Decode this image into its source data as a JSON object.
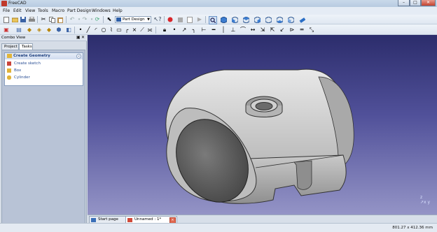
{
  "window": {
    "title": "FreeCAD",
    "minimize": "–",
    "maximize": "□",
    "close": "✕"
  },
  "menu": [
    "File",
    "Edit",
    "View",
    "Tools",
    "Macro",
    "Part Design",
    "Windows",
    "Help"
  ],
  "toolbar1": {
    "workbench": "Part Design",
    "icons": [
      "new-document-icon",
      "open-icon",
      "save-icon",
      "print-icon",
      "cut-icon",
      "copy-icon",
      "paste-icon",
      "undo-icon",
      "redo-icon",
      "refresh-icon",
      "pointer-icon",
      "whats-this-icon",
      "record-macro-icon",
      "stop-macro-icon",
      "edit-macro-icon",
      "run-macro-icon",
      "fit-all-icon",
      "axonometric-icon",
      "front-view-icon",
      "top-view-icon",
      "right-view-icon",
      "rear-view-icon",
      "bottom-view-icon",
      "left-view-icon",
      "measure-icon"
    ]
  },
  "toolbar2": {
    "icons": [
      "new-sketch-icon",
      "leave-sketch-icon",
      "view-sketch-icon",
      "map-sketch-icon",
      "reorient-sketch-icon",
      "validate-sketch-icon",
      "point-icon",
      "line-icon",
      "arc-icon",
      "circle-icon",
      "polyline-icon",
      "rectangle-icon",
      "fillet-icon",
      "trim-icon",
      "external-geometry-icon",
      "construction-mode-icon",
      "lock-constraint-icon",
      "coincident-constraint-icon",
      "point-on-object-icon",
      "vertical-constraint-icon",
      "horizontal-constraint-icon",
      "parallel-constraint-icon",
      "perpendicular-constraint-icon",
      "tangent-constraint-icon",
      "equal-constraint-icon",
      "symmetric-constraint-icon",
      "distance-constraint-icon",
      "horizontal-distance-icon",
      "vertical-distance-icon",
      "radius-constraint-icon",
      "angle-constraint-icon",
      "toggle-reference-icon"
    ]
  },
  "combo_view": {
    "title": "Combo View",
    "tabs": [
      "Project",
      "Tasks"
    ],
    "active_tab": "Tasks",
    "task_box": {
      "title": "Create Geometry",
      "items": [
        "Create sketch",
        "Box",
        "Cylinder"
      ]
    }
  },
  "doc_tabs": [
    {
      "label": "Start page"
    },
    {
      "label": "Unnamed : 1*"
    }
  ],
  "status": {
    "coords": "801.27 x 412.36 mm"
  },
  "colors": {
    "view_top": "#2c2d6c",
    "view_bottom": "#9494c6",
    "accent": "#2a4f95"
  }
}
